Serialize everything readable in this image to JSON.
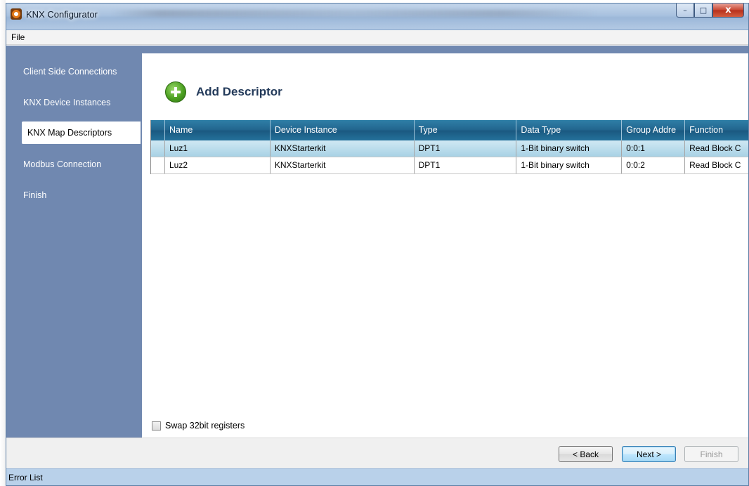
{
  "window": {
    "title": "KNX Configurator",
    "caption_buttons": {
      "minimize": "–",
      "maximize": "□",
      "close": "x"
    }
  },
  "menu": {
    "items": [
      "File"
    ]
  },
  "sidebar": {
    "items": [
      {
        "label": "Client Side Connections",
        "active": false
      },
      {
        "label": "KNX Device Instances",
        "active": false
      },
      {
        "label": "KNX Map Descriptors",
        "active": true
      },
      {
        "label": "Modbus Connection",
        "active": false
      },
      {
        "label": "Finish",
        "active": false
      }
    ]
  },
  "main": {
    "add_descriptor_label": "Add Descriptor",
    "table": {
      "headers": [
        "Name",
        "Device Instance",
        "Type",
        "Data Type",
        "Group Addre",
        "Function"
      ],
      "rows": [
        {
          "selected": true,
          "cells": [
            "Luz1",
            "KNXStarterkit",
            "DPT1",
            "1-Bit binary switch",
            "0:0:1",
            "Read Block C"
          ]
        },
        {
          "selected": false,
          "cells": [
            "Luz2",
            "KNXStarterkit",
            "DPT1",
            "1-Bit binary switch",
            "0:0:2",
            "Read Block C"
          ]
        }
      ]
    },
    "swap_registers": {
      "label": "Swap 32bit registers",
      "checked": false
    }
  },
  "footer": {
    "back_label": "< Back",
    "next_label": "Next >",
    "finish_label": "Finish"
  },
  "status_bar": {
    "label": "Error List"
  },
  "colors": {
    "sidebar_bg": "#7088b0",
    "header_bg": "#21648d",
    "selected_row": "#a8d2e5",
    "add_icon": "#4ca021"
  }
}
